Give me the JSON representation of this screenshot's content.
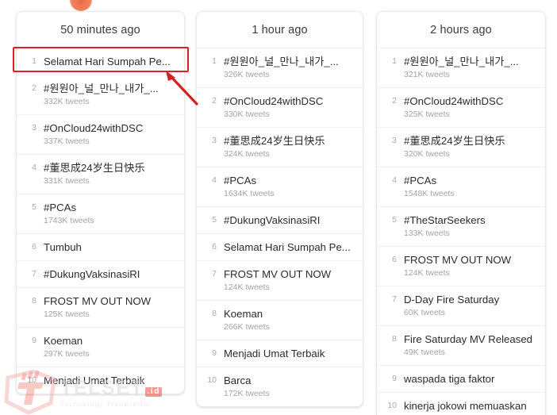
{
  "page": {
    "background_color": "#ffffff",
    "accent_color": "#ef4036",
    "annotation_color": "#e02020"
  },
  "watermark": {
    "brand": "TELSET",
    "suffix": ".id",
    "tagline": "Technology Trendsetter"
  },
  "annotation": {
    "highlight_target": "card-0 row 1",
    "arrow_label": "arrow-pointing-to-highlighted-trend"
  },
  "cards": [
    {
      "title": "50 minutes ago",
      "trends": [
        {
          "rank": "1",
          "name": "Selamat Hari Sumpah Pe...",
          "count": ""
        },
        {
          "rank": "2",
          "name": "#원원아_널_만나_내가_...",
          "count": "332K tweets"
        },
        {
          "rank": "3",
          "name": "#OnCloud24withDSC",
          "count": "337K tweets"
        },
        {
          "rank": "4",
          "name": "#董思成24岁生日快乐",
          "count": "331K tweets"
        },
        {
          "rank": "5",
          "name": "#PCAs",
          "count": "1743K tweets"
        },
        {
          "rank": "6",
          "name": "Tumbuh",
          "count": ""
        },
        {
          "rank": "7",
          "name": "#DukungVaksinasiRI",
          "count": ""
        },
        {
          "rank": "8",
          "name": "FROST MV OUT NOW",
          "count": "125K tweets"
        },
        {
          "rank": "9",
          "name": "Koeman",
          "count": "297K tweets"
        },
        {
          "rank": "10",
          "name": "Menjadi Umat Terbaik",
          "count": ""
        }
      ]
    },
    {
      "title": "1 hour ago",
      "trends": [
        {
          "rank": "1",
          "name": "#원원아_널_만나_내가_...",
          "count": "326K tweets"
        },
        {
          "rank": "2",
          "name": "#OnCloud24withDSC",
          "count": "330K tweets"
        },
        {
          "rank": "3",
          "name": "#董思成24岁生日快乐",
          "count": "324K tweets"
        },
        {
          "rank": "4",
          "name": "#PCAs",
          "count": "1634K tweets"
        },
        {
          "rank": "5",
          "name": "#DukungVaksinasiRI",
          "count": ""
        },
        {
          "rank": "6",
          "name": "Selamat Hari Sumpah Pe...",
          "count": ""
        },
        {
          "rank": "7",
          "name": "FROST MV OUT NOW",
          "count": "124K tweets"
        },
        {
          "rank": "8",
          "name": "Koeman",
          "count": "266K tweets"
        },
        {
          "rank": "9",
          "name": "Menjadi Umat Terbaik",
          "count": ""
        },
        {
          "rank": "10",
          "name": "Barca",
          "count": "172K tweets"
        }
      ]
    },
    {
      "title": "2 hours ago",
      "trends": [
        {
          "rank": "1",
          "name": "#원원아_널_만나_내가_...",
          "count": "321K tweets"
        },
        {
          "rank": "2",
          "name": "#OnCloud24withDSC",
          "count": "325K tweets"
        },
        {
          "rank": "3",
          "name": "#董思成24岁生日快乐",
          "count": "320K tweets"
        },
        {
          "rank": "4",
          "name": "#PCAs",
          "count": "1548K tweets"
        },
        {
          "rank": "5",
          "name": "#TheStarSeekers",
          "count": "133K tweets"
        },
        {
          "rank": "6",
          "name": "FROST MV OUT NOW",
          "count": "124K tweets"
        },
        {
          "rank": "7",
          "name": "D-Day Fire Saturday",
          "count": "60K tweets"
        },
        {
          "rank": "8",
          "name": "Fire Saturday MV Released",
          "count": "49K tweets"
        },
        {
          "rank": "9",
          "name": "waspada tiga faktor",
          "count": ""
        },
        {
          "rank": "10",
          "name": "kinerja jokowi memuaskan",
          "count": ""
        }
      ]
    }
  ]
}
